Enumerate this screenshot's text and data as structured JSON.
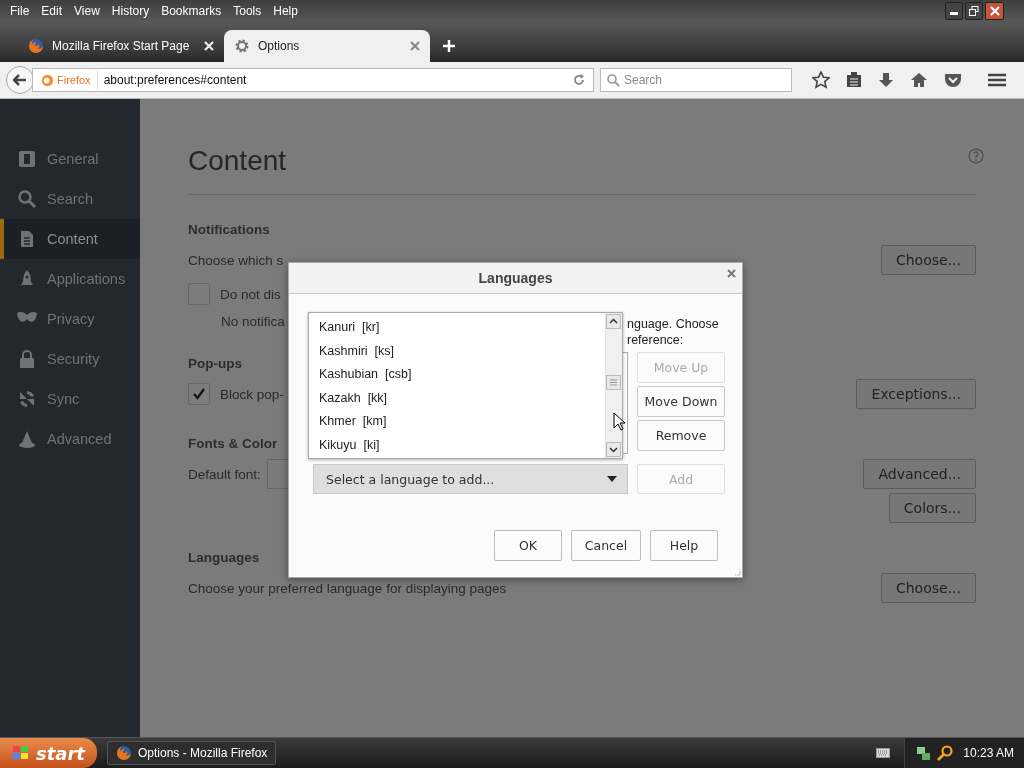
{
  "menu_bar": [
    "File",
    "Edit",
    "View",
    "History",
    "Bookmarks",
    "Tools",
    "Help"
  ],
  "tabs": [
    {
      "label": "Mozilla Firefox Start Page",
      "selected": false
    },
    {
      "label": "Options",
      "selected": true
    }
  ],
  "address_bar": {
    "identity": "Firefox",
    "url": "about:preferences#content"
  },
  "search": {
    "placeholder": "Search"
  },
  "sidebar": {
    "items": [
      {
        "label": "General",
        "selected": false
      },
      {
        "label": "Search",
        "selected": false
      },
      {
        "label": "Content",
        "selected": true
      },
      {
        "label": "Applications",
        "selected": false
      },
      {
        "label": "Privacy",
        "selected": false
      },
      {
        "label": "Security",
        "selected": false
      },
      {
        "label": "Sync",
        "selected": false
      },
      {
        "label": "Advanced",
        "selected": false
      }
    ]
  },
  "page": {
    "title": "Content",
    "sections": [
      {
        "heading": "Notifications",
        "rows": [
          {
            "kind": "text",
            "text": "Choose which s",
            "button": "Choose..."
          },
          {
            "kind": "checkbox",
            "text": "Do not dis",
            "checked": false
          },
          {
            "kind": "note",
            "text": "No notifica"
          }
        ]
      },
      {
        "heading": "Pop-ups",
        "rows": [
          {
            "kind": "checkbox",
            "text": "Block pop-",
            "checked": true,
            "button": "Exceptions..."
          }
        ]
      },
      {
        "heading": "Fonts & Color",
        "rows": [
          {
            "kind": "font",
            "text": "Default font:",
            "button": "Advanced..."
          },
          {
            "kind": "button",
            "button": "Colors..."
          }
        ]
      },
      {
        "heading": "Languages",
        "rows": [
          {
            "kind": "text",
            "text": "Choose your preferred language for displaying pages",
            "button": "Choose..."
          }
        ]
      }
    ]
  },
  "dialog": {
    "title": "Languages",
    "description": [
      "nguage. Choose",
      "reference:"
    ],
    "buttons": [
      {
        "label": "Move Up",
        "disabled": true
      },
      {
        "label": "Move Down",
        "disabled": false
      },
      {
        "label": "Remove",
        "disabled": false
      }
    ],
    "dropdown": {
      "value": "Select a language to add..."
    },
    "add_button": {
      "label": "Add",
      "disabled": true
    },
    "popup_items": [
      "Kanuri  [kr]",
      "Kashmiri  [ks]",
      "Kashubian  [csb]",
      "Kazakh  [kk]",
      "Khmer  [km]",
      "Kikuyu  [ki]"
    ],
    "footer_buttons": [
      "OK",
      "Cancel",
      "Help"
    ]
  },
  "taskbar": {
    "start": "start",
    "tasks": [
      {
        "label": "Options - Mozilla Firefox",
        "selected": false
      }
    ],
    "clock": "10:23 AM"
  }
}
